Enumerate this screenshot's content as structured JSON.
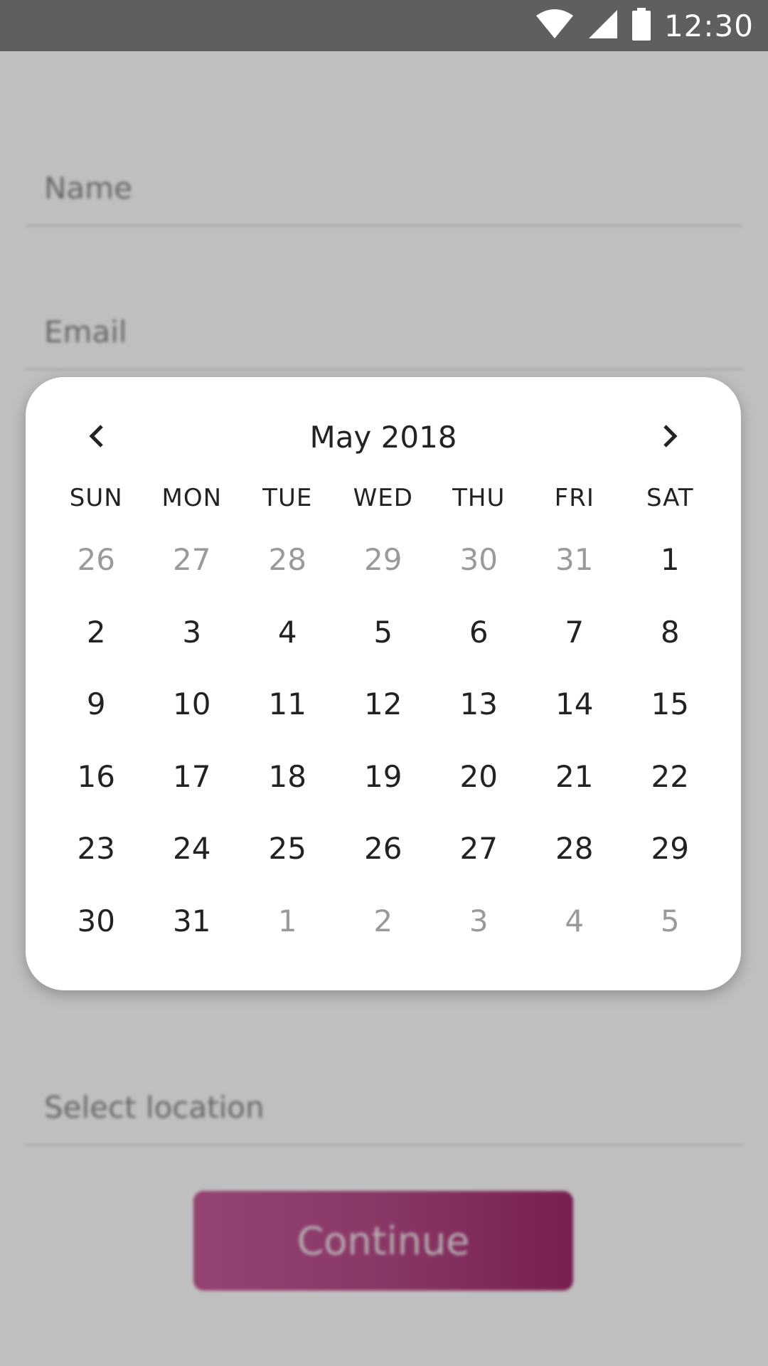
{
  "status_bar": {
    "time": "12:30",
    "icons": [
      "wifi-icon",
      "cell-signal-icon",
      "battery-icon"
    ]
  },
  "form": {
    "name_placeholder": "Name",
    "email_placeholder": "Email",
    "location_placeholder": "Select location",
    "continue_label": "Continue"
  },
  "calendar": {
    "title": "May 2018",
    "prev_icon": "chevron-left-icon",
    "next_icon": "chevron-right-icon",
    "weekdays": [
      "SUN",
      "MON",
      "TUE",
      "WED",
      "THU",
      "FRI",
      "SAT"
    ],
    "days": [
      {
        "label": "26",
        "in_month": false
      },
      {
        "label": "27",
        "in_month": false
      },
      {
        "label": "28",
        "in_month": false
      },
      {
        "label": "29",
        "in_month": false
      },
      {
        "label": "30",
        "in_month": false
      },
      {
        "label": "31",
        "in_month": false
      },
      {
        "label": "1",
        "in_month": true
      },
      {
        "label": "2",
        "in_month": true
      },
      {
        "label": "3",
        "in_month": true
      },
      {
        "label": "4",
        "in_month": true
      },
      {
        "label": "5",
        "in_month": true
      },
      {
        "label": "6",
        "in_month": true
      },
      {
        "label": "7",
        "in_month": true
      },
      {
        "label": "8",
        "in_month": true
      },
      {
        "label": "9",
        "in_month": true
      },
      {
        "label": "10",
        "in_month": true
      },
      {
        "label": "11",
        "in_month": true
      },
      {
        "label": "12",
        "in_month": true
      },
      {
        "label": "13",
        "in_month": true
      },
      {
        "label": "14",
        "in_month": true
      },
      {
        "label": "15",
        "in_month": true
      },
      {
        "label": "16",
        "in_month": true
      },
      {
        "label": "17",
        "in_month": true
      },
      {
        "label": "18",
        "in_month": true
      },
      {
        "label": "19",
        "in_month": true
      },
      {
        "label": "20",
        "in_month": true
      },
      {
        "label": "21",
        "in_month": true
      },
      {
        "label": "22",
        "in_month": true
      },
      {
        "label": "23",
        "in_month": true
      },
      {
        "label": "24",
        "in_month": true
      },
      {
        "label": "25",
        "in_month": true
      },
      {
        "label": "26",
        "in_month": true
      },
      {
        "label": "27",
        "in_month": true
      },
      {
        "label": "28",
        "in_month": true
      },
      {
        "label": "29",
        "in_month": true
      },
      {
        "label": "30",
        "in_month": true
      },
      {
        "label": "31",
        "in_month": true
      },
      {
        "label": "1",
        "in_month": false
      },
      {
        "label": "2",
        "in_month": false
      },
      {
        "label": "3",
        "in_month": false
      },
      {
        "label": "4",
        "in_month": false
      },
      {
        "label": "5",
        "in_month": false
      }
    ]
  },
  "colors": {
    "status_bar": "#5f5f61",
    "scrim": "#000000",
    "button_gradient_start": "#c75a9a",
    "button_gradient_end": "#a12b6b",
    "day_text": "#222222",
    "muted_day_text": "#9a9a9a"
  }
}
